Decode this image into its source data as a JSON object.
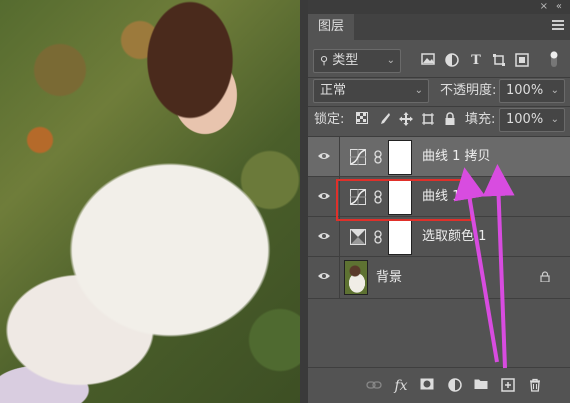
{
  "panel": {
    "tab_label": "图层",
    "collapse_glyph": "«",
    "close_glyph": "×"
  },
  "filter": {
    "kind_label": "类型",
    "icons": [
      "image-filter-icon",
      "adjustment-filter-icon",
      "text-filter-icon",
      "shape-filter-icon",
      "smart-object-filter-icon",
      "filter-toggle-icon"
    ]
  },
  "blend": {
    "mode": "正常",
    "opacity_label": "不透明度:",
    "opacity_value": "100%"
  },
  "lock": {
    "label": "锁定:",
    "fill_label": "填充:",
    "fill_value": "100%"
  },
  "layers": [
    {
      "name": "曲线 1 拷贝",
      "type": "curves-adjustment",
      "visible": true,
      "selected": true
    },
    {
      "name": "曲线 1",
      "type": "curves-adjustment",
      "visible": true,
      "selected": false,
      "highlighted": true
    },
    {
      "name": "选取颜色 1",
      "type": "selective-color-adjustment",
      "visible": true,
      "selected": false
    },
    {
      "name": "背景",
      "type": "image",
      "visible": true,
      "selected": false,
      "locked": true
    }
  ],
  "bottom_bar": {
    "fx_label": "fx",
    "icons": [
      "link-layers-icon",
      "fx-icon",
      "add-mask-icon",
      "adjustment-layer-icon",
      "group-folder-icon",
      "new-layer-icon",
      "trash-icon"
    ]
  },
  "annotation": {
    "highlight_color": "#e0302a",
    "arrow_color": "#d84ce0"
  }
}
